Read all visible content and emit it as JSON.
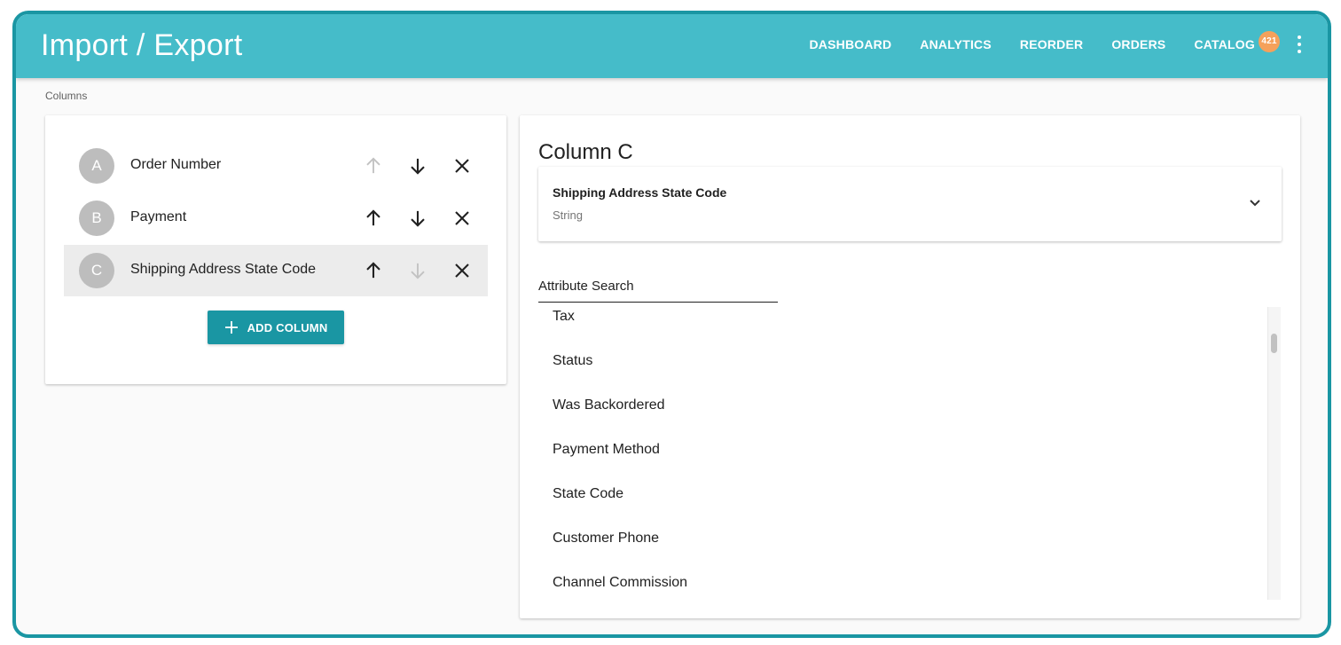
{
  "app": {
    "title": "Import / Export"
  },
  "nav": {
    "items": [
      {
        "label": "DASHBOARD"
      },
      {
        "label": "ANALYTICS"
      },
      {
        "label": "REORDER"
      },
      {
        "label": "ORDERS"
      },
      {
        "label": "CATALOG",
        "badge": "421"
      }
    ],
    "more_icon": "more-vert-icon"
  },
  "columns_section": {
    "label": "Columns",
    "rows": [
      {
        "letter": "A",
        "name": "Order Number",
        "up_enabled": false,
        "down_enabled": true,
        "selected": false
      },
      {
        "letter": "B",
        "name": "Payment",
        "up_enabled": true,
        "down_enabled": true,
        "selected": false
      },
      {
        "letter": "C",
        "name": "Shipping Address State Code",
        "up_enabled": true,
        "down_enabled": false,
        "selected": true
      }
    ],
    "add_button_label": "ADD COLUMN"
  },
  "detail": {
    "heading": "Column C",
    "field": {
      "title": "Shipping Address State Code",
      "type": "String"
    },
    "search": {
      "label": "Attribute Search",
      "value": ""
    },
    "attributes": [
      "Tax",
      "Status",
      "Was Backordered",
      "Payment Method",
      "State Code",
      "Customer Phone",
      "Channel Commission"
    ]
  },
  "colors": {
    "appbar": "#45bcc9",
    "accent": "#1a96a3",
    "badge": "#f5a15b",
    "frame": "#1a96a3"
  }
}
